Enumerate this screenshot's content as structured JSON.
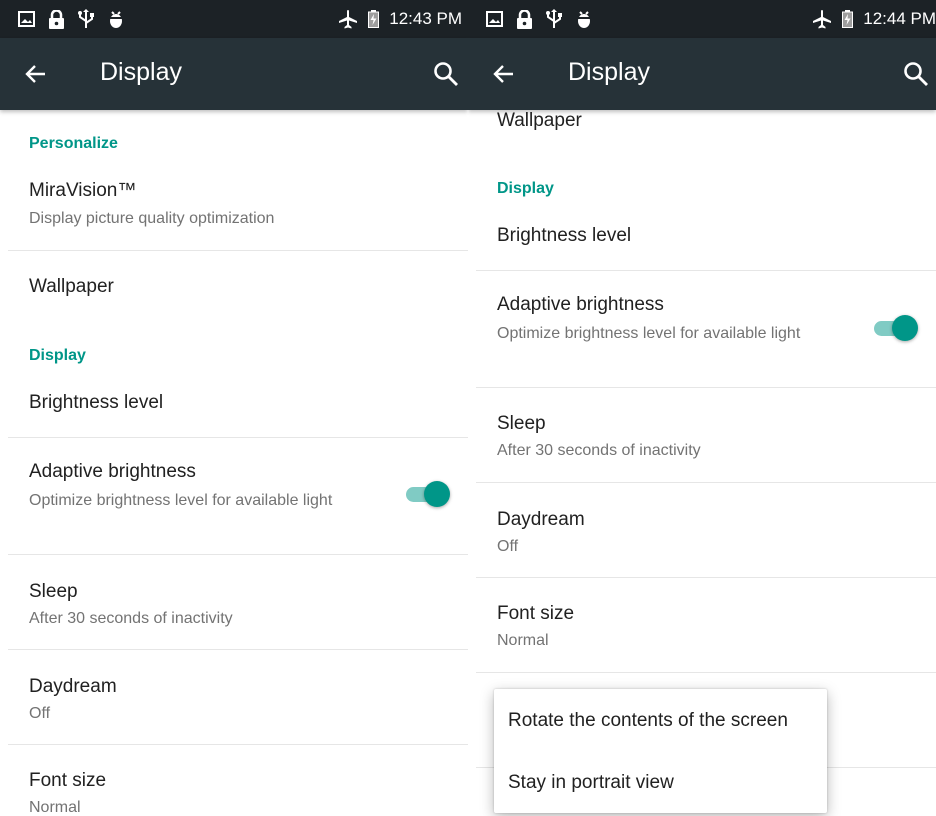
{
  "left": {
    "status": {
      "time": "12:43 PM",
      "icons": [
        "image-icon",
        "lock-icon",
        "usb-icon",
        "debug-icon"
      ],
      "right_icons": [
        "airplane-icon",
        "battery-charging-icon"
      ]
    },
    "appbar": {
      "title": "Display",
      "back_icon": "arrow-back-icon",
      "search_icon": "search-icon"
    },
    "categories": {
      "personalize": "Personalize",
      "display": "Display"
    },
    "items": {
      "miravision": {
        "title": "MiraVision™",
        "summary": "Display picture quality optimization"
      },
      "wallpaper": {
        "title": "Wallpaper"
      },
      "brightness": {
        "title": "Brightness level"
      },
      "adaptive": {
        "title": "Adaptive brightness",
        "summary": "Optimize brightness level for available light",
        "enabled": true
      },
      "sleep": {
        "title": "Sleep",
        "summary": "After 30 seconds of inactivity"
      },
      "daydream": {
        "title": "Daydream",
        "summary": "Off"
      },
      "fontsize": {
        "title": "Font size",
        "summary": "Normal"
      }
    }
  },
  "right": {
    "status": {
      "time": "12:44 PM",
      "icons": [
        "image-icon",
        "lock-icon",
        "usb-icon",
        "debug-icon"
      ],
      "right_icons": [
        "airplane-icon",
        "battery-charging-icon"
      ]
    },
    "appbar": {
      "title": "Display",
      "back_icon": "arrow-back-icon",
      "search_icon": "search-icon"
    },
    "categories": {
      "display": "Display"
    },
    "items": {
      "wallpaper": {
        "title": "Wallpaper"
      },
      "brightness": {
        "title": "Brightness level"
      },
      "adaptive": {
        "title": "Adaptive brightness",
        "summary": "Optimize brightness level for available light",
        "enabled": true
      },
      "sleep": {
        "title": "Sleep",
        "summary": "After 30 seconds of inactivity"
      },
      "daydream": {
        "title": "Daydream",
        "summary": "Off"
      },
      "fontsize": {
        "title": "Font size",
        "summary": "Normal"
      }
    },
    "popup": {
      "options": [
        "Rotate the contents of the screen",
        "Stay in portrait view"
      ]
    }
  },
  "colors": {
    "statusbar": "#1c2226",
    "appbar": "#263238",
    "accent": "#009688",
    "accent_light": "#80cbc4"
  }
}
